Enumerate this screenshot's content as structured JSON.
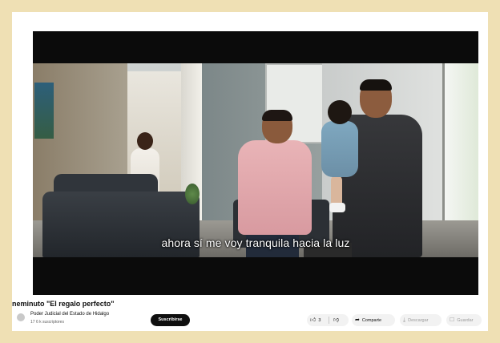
{
  "video": {
    "subtitle": "ahora sí me voy tranquila hacia la luz"
  },
  "title": "neminuto \"El regalo perfecto\"",
  "channel": {
    "name": "Poder Judicial del Estado de Hidalgo",
    "subscribers": "17 6 k suscriptores",
    "subscribe_label": "Suscribirse"
  },
  "actions": {
    "like_count": "3",
    "share_label": "Comparte",
    "download_label": "Descargar",
    "save_label": "Guardar"
  },
  "icons": {
    "like": "thumbs-up-icon",
    "dislike": "thumbs-down-icon",
    "share": "share-arrow-icon",
    "download": "download-icon",
    "save": "bookmark-icon"
  },
  "colors": {
    "border": "#efe0b4",
    "subscribe_bg": "#0f0f0f",
    "pill_bg": "#f2f2f2"
  }
}
